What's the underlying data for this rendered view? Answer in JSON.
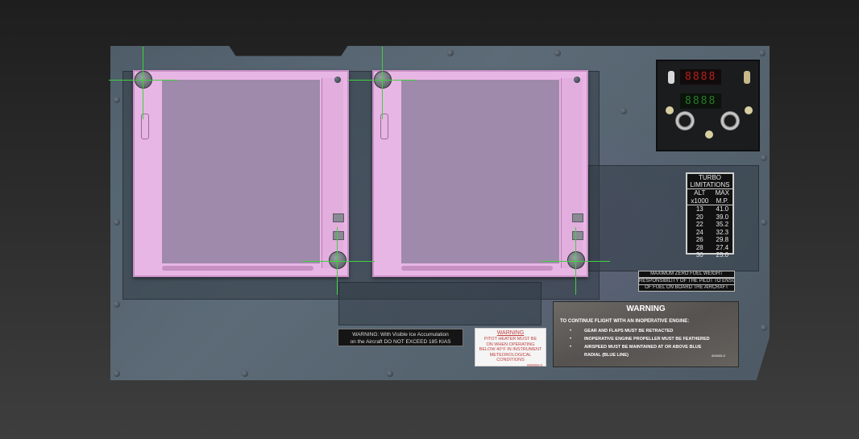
{
  "mfd_left": {
    "name": "left-mfd"
  },
  "mfd_right": {
    "name": "right-mfd"
  },
  "readouts": {
    "top_digits": "8888",
    "bottom_digits": "8888",
    "top_color": "#b3201c",
    "bottom_color": "#2a7a2a"
  },
  "turbo": {
    "title_line1": "TURBO",
    "title_line2": "LIMITATIONS",
    "col1_head": "ALT",
    "col1_sub": "x1000",
    "col2_head": "MAX",
    "col2_sub": "M.P.",
    "rows": [
      [
        "13",
        "41.0"
      ],
      [
        "20",
        "39.0"
      ],
      [
        "22",
        "35.2"
      ],
      [
        "24",
        "32.3"
      ],
      [
        "26",
        "29.8"
      ],
      [
        "28",
        "27.4"
      ],
      [
        "30",
        "25.0"
      ]
    ]
  },
  "fuel_strips": [
    "MAXIMUM ZERO FUEL WEIGHT",
    "RESPONSIBILITY OF THE PILOT TO ENSURE",
    "OF FUEL ON BOARD THE AIRCRAFT"
  ],
  "ice_warning": {
    "line1": "WARNING: With Visible Ice Accumulation",
    "line2": "on the Aircraft DO NOT EXCEED 185 KIAS"
  },
  "pitot_placard": {
    "title": "WARNING",
    "lines": [
      "PITOT HEATER MUST BE",
      "ON WHEN OPERATING",
      "BELOW 40°F IN INSTRUMENT",
      "METEOROLOGICAL CONDITIONS"
    ],
    "code": "000000-0"
  },
  "engine_warning": {
    "title": "WARNING",
    "subtitle": "TO CONTINUE FLIGHT WITH AN INOPERATIVE ENGINE:",
    "items": [
      "GEAR AND FLAPS MUST BE RETRACTED",
      "INOPERATIVE ENGINE PROPELLER MUST BE FEATHERED",
      "AIRSPEED MUST BE MAINTAINED AT OR ABOVE BLUE",
      "RADIAL (BLUE LINE)"
    ],
    "code": "000000-0"
  },
  "colors": {
    "panel": "#56646f",
    "mfd_bezel": "#e8b6e4",
    "mfd_screen": "#a08aab",
    "guide_lines": "#3fd03f"
  }
}
